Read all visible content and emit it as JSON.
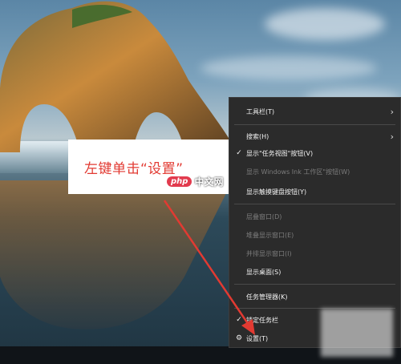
{
  "context_menu": {
    "items": [
      {
        "label": "工具栏(T)",
        "checked": false,
        "disabled": false,
        "submenu": true
      },
      {
        "label": "搜索(H)",
        "checked": false,
        "disabled": false,
        "submenu": true
      },
      {
        "label": "显示\"任务视图\"按钮(V)",
        "checked": true,
        "disabled": false,
        "submenu": false
      },
      {
        "label": "显示 Windows Ink 工作区\"按钮(W)",
        "checked": false,
        "disabled": true,
        "submenu": false
      },
      {
        "label": "显示触摸键盘按钮(Y)",
        "checked": false,
        "disabled": false,
        "submenu": false
      },
      {
        "label": "层叠窗口(D)",
        "checked": false,
        "disabled": true,
        "submenu": false
      },
      {
        "label": "堆叠显示窗口(E)",
        "checked": false,
        "disabled": true,
        "submenu": false
      },
      {
        "label": "并排显示窗口(I)",
        "checked": false,
        "disabled": true,
        "submenu": false
      },
      {
        "label": "显示桌面(S)",
        "checked": false,
        "disabled": false,
        "submenu": false
      },
      {
        "label": "任务管理器(K)",
        "checked": false,
        "disabled": false,
        "submenu": false
      },
      {
        "label": "锁定任务栏",
        "checked": true,
        "disabled": false,
        "submenu": false
      },
      {
        "label": "设置(T)",
        "checked": false,
        "disabled": false,
        "submenu": false,
        "icon": "gear-icon"
      }
    ]
  },
  "annotation": {
    "text": "左键单击“设置”",
    "color": "#e23a32"
  },
  "watermark": {
    "badge": "php",
    "text": "中文网"
  }
}
